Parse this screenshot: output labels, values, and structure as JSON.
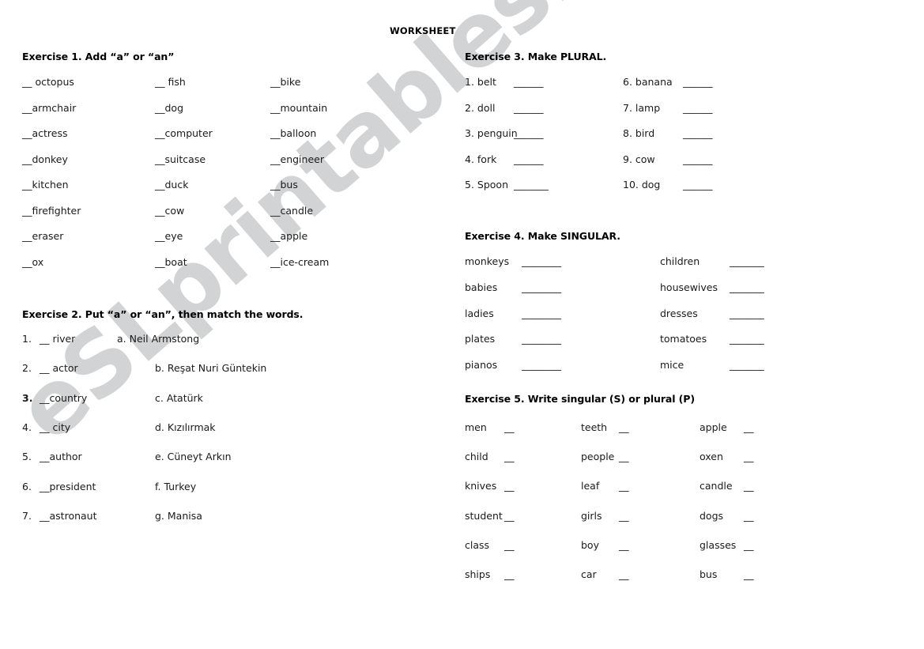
{
  "document": {
    "title": "WORKSHEET",
    "watermark": "eSLprintables.com"
  },
  "exercise1": {
    "heading": "Exercise 1. Add  “a”  or  “an”",
    "col1": [
      "__ octopus",
      "__armchair",
      "__actress",
      "__donkey",
      "__kitchen",
      "__firefighter",
      "__eraser",
      "__ox"
    ],
    "col2": [
      "__ fish",
      "__dog",
      "__computer",
      "__suitcase",
      "__duck",
      "__cow",
      "__eye",
      "__boat"
    ],
    "col3": [
      "__bike",
      "__mountain",
      "__balloon",
      "__engineer",
      "__bus",
      "__candle",
      "__apple",
      "__ice-cream"
    ]
  },
  "exercise2": {
    "heading": "Exercise 2. Put “a” or “an”, then match the words.",
    "left": [
      {
        "num": "1.",
        "word": "__ river",
        "bold": false
      },
      {
        "num": "2.",
        "word": "__ actor",
        "bold": false
      },
      {
        "num": "3.",
        "word": "__country",
        "bold": true
      },
      {
        "num": "4.",
        "word": "__ city",
        "bold": false
      },
      {
        "num": "5.",
        "word": "__author",
        "bold": false
      },
      {
        "num": "6.",
        "word": "__president",
        "bold": false
      },
      {
        "num": "7.",
        "word": "__astronaut",
        "bold": false
      }
    ],
    "right": [
      "a. Neil Armstong",
      "b. Reşat Nuri Güntekin",
      "c. Atatürk",
      "d. Kızılırmak",
      "e. Cüneyt Arkın",
      "f. Turkey",
      "g. Manisa"
    ]
  },
  "exercise3": {
    "heading": "Exercise 3. Make PLURAL.",
    "col1": [
      {
        "label": "1. belt",
        "blank": "______"
      },
      {
        "label": "2. doll",
        "blank": "______"
      },
      {
        "label": "3. penguin",
        "blank": "______"
      },
      {
        "label": "4. fork",
        "blank": "______"
      },
      {
        "label": "5. Spoon",
        "blank": "_______"
      }
    ],
    "col2": [
      {
        "label": "6. banana",
        "blank": "______"
      },
      {
        "label": "7. lamp",
        "blank": "______"
      },
      {
        "label": "8. bird",
        "blank": "______"
      },
      {
        "label": "9. cow",
        "blank": "______"
      },
      {
        "label": "10. dog",
        "blank": "______"
      }
    ]
  },
  "exercise4": {
    "heading": "Exercise 4. Make SINGULAR.",
    "col1": [
      {
        "label": "monkeys",
        "blank": "________"
      },
      {
        "label": "babies",
        "blank": "________"
      },
      {
        "label": "ladies",
        "blank": "________"
      },
      {
        "label": "plates",
        "blank": "________"
      },
      {
        "label": "pianos",
        "blank": "________"
      }
    ],
    "col2": [
      {
        "label": "children",
        "blank": "_______"
      },
      {
        "label": "housewives",
        "blank": "_______"
      },
      {
        "label": "dresses",
        "blank": "_______"
      },
      {
        "label": "tomatoes",
        "blank": "_______"
      },
      {
        "label": "mice",
        "blank": "_______"
      }
    ]
  },
  "exercise5": {
    "heading": "Exercise 5. Write singular (S) or plural (P)",
    "col1": [
      {
        "label": "men",
        "blank": "__"
      },
      {
        "label": "child",
        "blank": "__"
      },
      {
        "label": "knives",
        "blank": "__"
      },
      {
        "label": "student",
        "blank": "__"
      },
      {
        "label": "class",
        "blank": "__"
      },
      {
        "label": "ships",
        "blank": "__"
      }
    ],
    "col2": [
      {
        "label": "teeth",
        "blank": "__"
      },
      {
        "label": "people",
        "blank": "__"
      },
      {
        "label": "leaf",
        "blank": "__"
      },
      {
        "label": "girls",
        "blank": "__"
      },
      {
        "label": "boy",
        "blank": "__"
      },
      {
        "label": "car",
        "blank": "__"
      }
    ],
    "col3": [
      {
        "label": "apple",
        "blank": "__"
      },
      {
        "label": "oxen",
        "blank": "__"
      },
      {
        "label": "candle",
        "blank": "__"
      },
      {
        "label": "dogs",
        "blank": "__"
      },
      {
        "label": "glasses",
        "blank": "__"
      },
      {
        "label": "bus",
        "blank": "__"
      }
    ]
  }
}
